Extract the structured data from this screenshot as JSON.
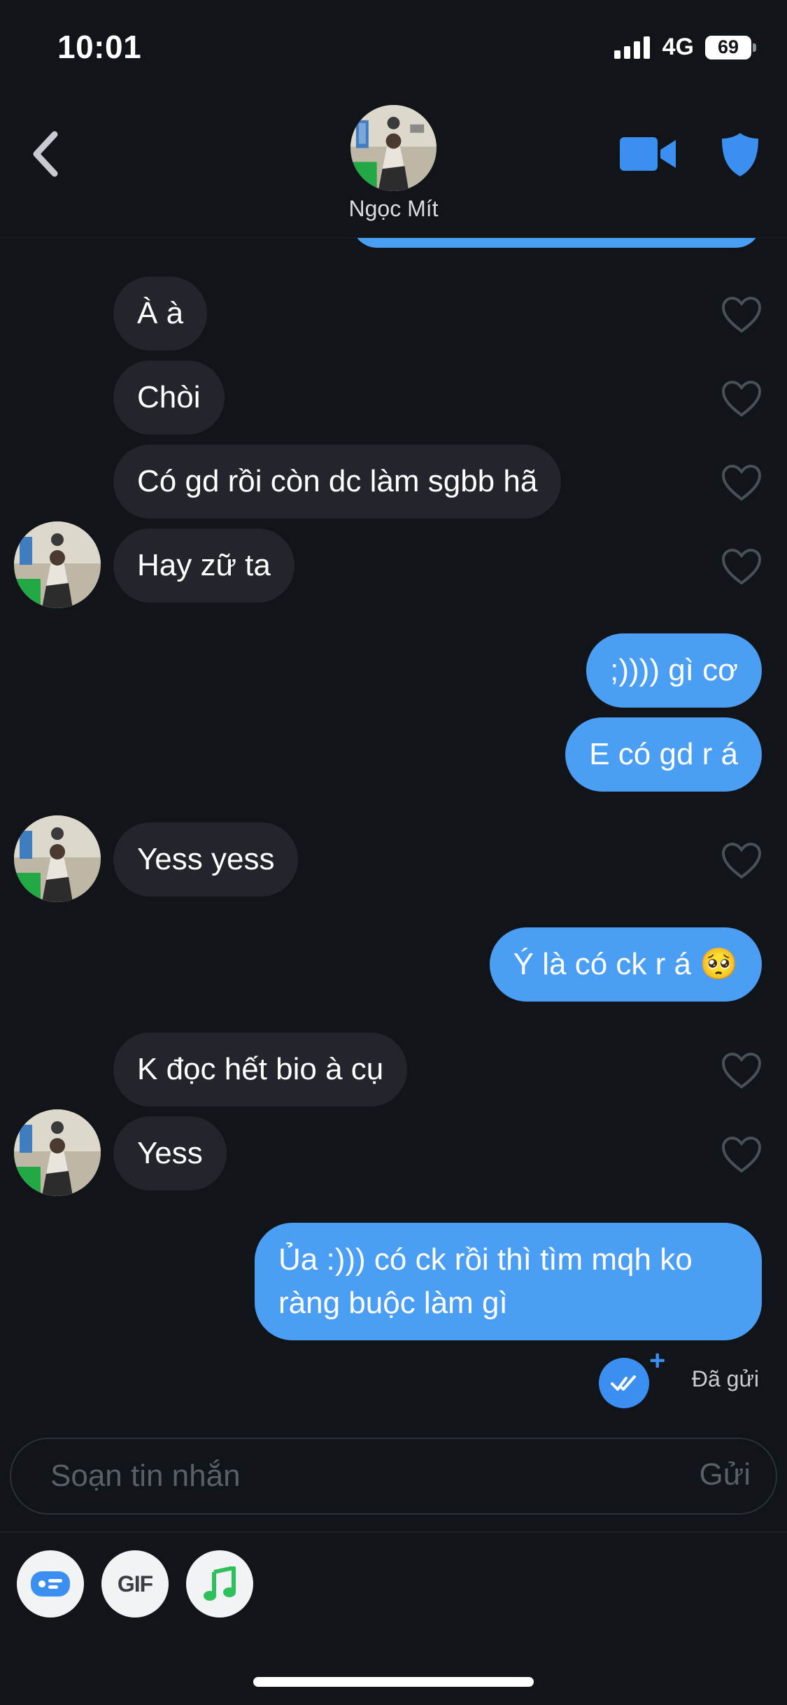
{
  "status_bar": {
    "time": "10:01",
    "network": "4G",
    "battery": "69"
  },
  "header": {
    "contact_name": "Ngọc Mít",
    "accent_color": "#4a9ff5"
  },
  "messages": [
    {
      "id": "m1",
      "direction": "incoming",
      "text": "À à"
    },
    {
      "id": "m2",
      "direction": "incoming",
      "text": "Chòi"
    },
    {
      "id": "m3",
      "direction": "incoming",
      "text": "Có gd rồi còn dc làm sgbb hã"
    },
    {
      "id": "m4",
      "direction": "incoming",
      "text": "Hay zữ ta"
    },
    {
      "id": "m5",
      "direction": "outgoing",
      "text": ";)))) gì cơ"
    },
    {
      "id": "m6",
      "direction": "outgoing",
      "text": "E có gd r á"
    },
    {
      "id": "m7",
      "direction": "incoming",
      "text": "Yess yess"
    },
    {
      "id": "m8",
      "direction": "outgoing",
      "text": "Ý là có ck r á 🥺"
    },
    {
      "id": "m9",
      "direction": "incoming",
      "text": "K đọc hết bio à cụ"
    },
    {
      "id": "m10",
      "direction": "incoming",
      "text": "Yess"
    },
    {
      "id": "m11",
      "direction": "outgoing",
      "text": "Ủa :))) có ck rồi thì tìm mqh ko ràng buộc làm gì"
    }
  ],
  "delivery": {
    "status": "Đã gửi"
  },
  "composer": {
    "placeholder": "Soạn tin nhắn",
    "send_label": "Gửi"
  },
  "toolbar": {
    "gif_label": "GIF",
    "icons": [
      "card-icon",
      "gif-icon",
      "music-note-icon"
    ]
  }
}
